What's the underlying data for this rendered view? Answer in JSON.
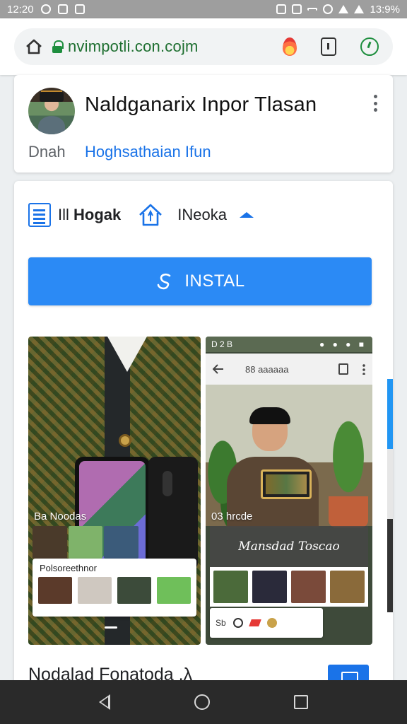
{
  "status_bar": {
    "time": "12:20",
    "battery": "13:9%"
  },
  "browser": {
    "url": "nvimpotli.con.cojm"
  },
  "app": {
    "name": "Naldganarix Inpor Tlasan",
    "author": "Dnah",
    "category": "Hoghsathaian Ifun"
  },
  "stats": {
    "reviews_prefix": "Ill",
    "reviews_label": "Hogak",
    "rating_label": "INeoka"
  },
  "install": {
    "label": "INSTAL"
  },
  "screenshots": [
    {
      "caption": "Ba Noodas",
      "popup_title": "Polsoreethnor",
      "thumb_colors": [
        "#4a3a2a",
        "#7fb36a",
        "#3b5b7a"
      ],
      "popup_thumb_colors": [
        "#5b3a2a",
        "#cfc8c0",
        "#3c4b3a",
        "#6fbf5a"
      ]
    },
    {
      "status_left": "D 2 B",
      "status_right": "● ● ● ■",
      "topbar_title": "88 aaaaaa",
      "caption": "03 hrcde",
      "banner": "Mansdad Toscao",
      "thumb_colors": [
        "#4b6a3a",
        "#2a2a3a",
        "#7a4a3a",
        "#8a6a3a"
      ],
      "share_label": "Sb"
    }
  ],
  "section": {
    "title": "Nodalad Fonatoda ,λ"
  },
  "colors": {
    "accent": "#1a73e8",
    "install_button": "#2b8af5",
    "url_secure": "#1e8e3e"
  },
  "icons": [
    "home-icon",
    "lock-icon",
    "flame-icon",
    "tabs-icon",
    "clock-icon",
    "more-vert-icon",
    "document-icon",
    "house-icon",
    "caret-up-icon",
    "install-icon",
    "back-icon",
    "home-circle-icon",
    "recent-apps-icon"
  ]
}
